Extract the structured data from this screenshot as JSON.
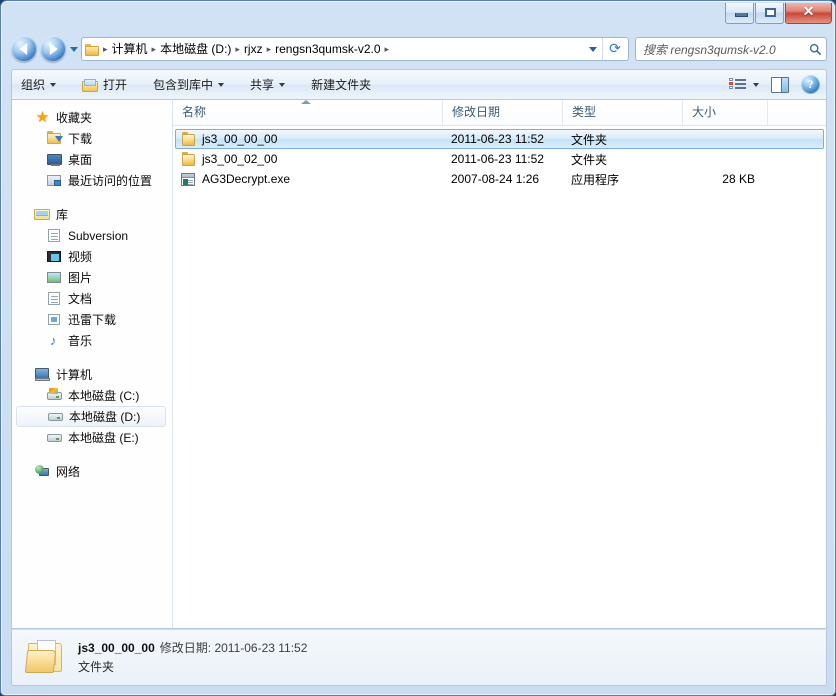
{
  "window": {
    "controls": {
      "minimize_label": "—",
      "maximize_label": "",
      "close_label": "✕"
    }
  },
  "address": {
    "back_icon": "back-arrow-icon",
    "forward_icon": "forward-arrow-icon",
    "history_icon": "history-dropdown-icon",
    "folder_icon": "folder-icon",
    "breadcrumbs": [
      "计算机",
      "本地磁盘 (D:)",
      "rjxz",
      "rengsn3qumsk-v2.0"
    ],
    "separator": "▸",
    "dropdown_icon": "chevron-down-icon",
    "refresh_icon": "↻",
    "refresh_glyph": "⟳"
  },
  "search": {
    "placeholder": "搜索 rengsn3qumsk-v2.0",
    "icon": "search-icon"
  },
  "toolbar": {
    "organize_label": "组织",
    "open_label": "打开",
    "include_label": "包含到库中",
    "share_label": "共享",
    "newfolder_label": "新建文件夹",
    "views_icon": "view-options-icon",
    "preview_icon": "preview-pane-icon",
    "help_icon": "help-icon",
    "help_glyph": "?"
  },
  "sidebar": {
    "groups": [
      {
        "header": {
          "label": "收藏夹",
          "icon": "star-icon"
        },
        "items": [
          {
            "label": "下载",
            "icon": "downloads-icon"
          },
          {
            "label": "桌面",
            "icon": "desktop-icon"
          },
          {
            "label": "最近访问的位置",
            "icon": "recent-places-icon"
          }
        ]
      },
      {
        "header": {
          "label": "库",
          "icon": "library-icon"
        },
        "items": [
          {
            "label": "Subversion",
            "icon": "subversion-icon"
          },
          {
            "label": "视频",
            "icon": "video-icon"
          },
          {
            "label": "图片",
            "icon": "pictures-icon"
          },
          {
            "label": "文档",
            "icon": "documents-icon"
          },
          {
            "label": "迅雷下载",
            "icon": "xunlei-downloads-icon"
          },
          {
            "label": "音乐",
            "icon": "music-icon"
          }
        ]
      },
      {
        "header": {
          "label": "计算机",
          "icon": "computer-icon"
        },
        "items": [
          {
            "label": "本地磁盘 (C:)",
            "icon": "system-drive-icon",
            "selected": false
          },
          {
            "label": "本地磁盘 (D:)",
            "icon": "drive-icon",
            "selected": true
          },
          {
            "label": "本地磁盘 (E:)",
            "icon": "drive-icon",
            "selected": false
          }
        ]
      },
      {
        "header": {
          "label": "网络",
          "icon": "network-icon"
        },
        "items": []
      }
    ]
  },
  "filelist": {
    "columns": [
      {
        "key": "name",
        "label": "名称",
        "sorted": "asc"
      },
      {
        "key": "date",
        "label": "修改日期"
      },
      {
        "key": "type",
        "label": "类型"
      },
      {
        "key": "size",
        "label": "大小"
      }
    ],
    "rows": [
      {
        "name": "js3_00_00_00",
        "date": "2011-06-23 11:52",
        "type": "文件夹",
        "size": "",
        "icon": "folder-icon",
        "selected": true
      },
      {
        "name": "js3_00_02_00",
        "date": "2011-06-23 11:52",
        "type": "文件夹",
        "size": "",
        "icon": "folder-icon",
        "selected": false
      },
      {
        "name": "AG3Decrypt.exe",
        "date": "2007-08-24 1:26",
        "type": "应用程序",
        "size": "28 KB",
        "icon": "application-icon",
        "selected": false
      }
    ]
  },
  "statusbar": {
    "icon": "folder-large-icon",
    "name": "js3_00_00_00",
    "date_label": "修改日期:",
    "date_value": "2011-06-23 11:52",
    "type": "文件夹"
  }
}
